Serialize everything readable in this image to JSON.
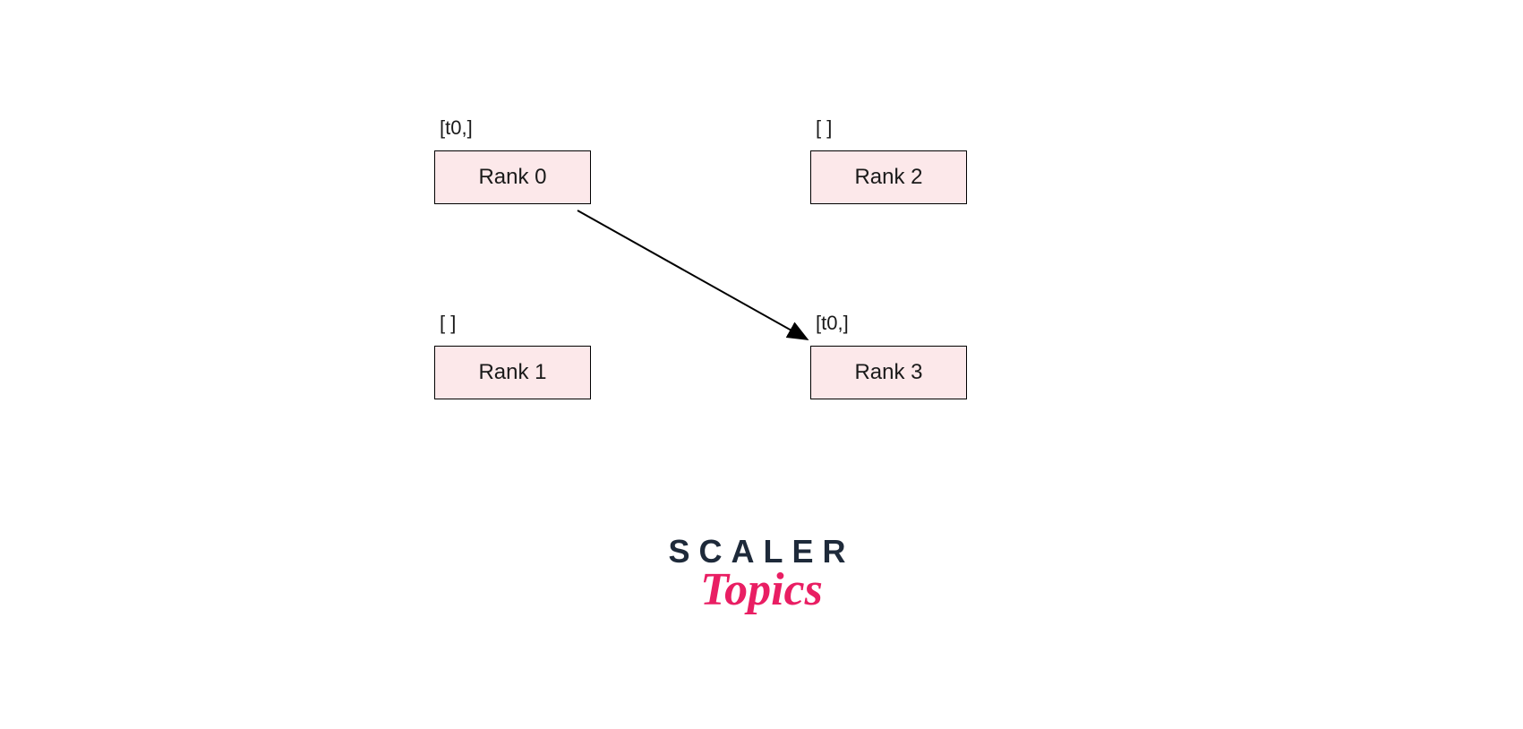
{
  "nodes": [
    {
      "id": "rank0",
      "label": "[t0,]",
      "name": "Rank 0"
    },
    {
      "id": "rank1",
      "label": "[ ]",
      "name": "Rank 1"
    },
    {
      "id": "rank2",
      "label": "[ ]",
      "name": "Rank 2"
    },
    {
      "id": "rank3",
      "label": "[t0,]",
      "name": "Rank 3"
    }
  ],
  "arrow": {
    "from": "rank0",
    "to": "rank3"
  },
  "logo": {
    "line1": "SCALER",
    "line2": "Topics"
  }
}
